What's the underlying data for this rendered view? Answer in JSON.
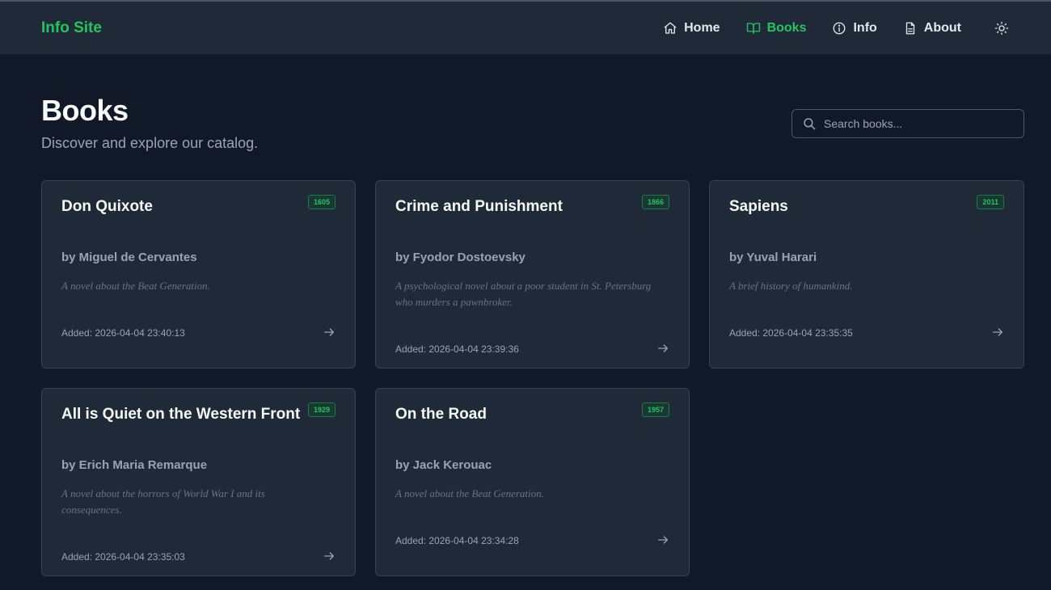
{
  "brand": "Info Site",
  "nav": {
    "home": "Home",
    "books": "Books",
    "info": "Info",
    "about": "About"
  },
  "page": {
    "title": "Books",
    "subtitle": "Discover and explore our catalog."
  },
  "search": {
    "placeholder": "Search books..."
  },
  "colors": {
    "accent": "#22c55e",
    "background": "#111827",
    "card": "#1f2937"
  },
  "books": [
    {
      "title": "Don Quixote",
      "year": "1605",
      "author": "by Miguel de Cervantes",
      "description": "A novel about the Beat Generation.",
      "added": "Added: 2026-04-04 23:40:13"
    },
    {
      "title": "Crime and Punishment",
      "year": "1866",
      "author": "by Fyodor Dostoevsky",
      "description": "A psychological novel about a poor student in St. Petersburg who murders a pawnbroker.",
      "added": "Added: 2026-04-04 23:39:36"
    },
    {
      "title": "Sapiens",
      "year": "2011",
      "author": "by Yuval Harari",
      "description": "A brief history of humankind.",
      "added": "Added: 2026-04-04 23:35:35"
    },
    {
      "title": "All is Quiet on the Western Front",
      "year": "1929",
      "author": "by Erich Maria Remarque",
      "description": "A novel about the horrors of World War I and its consequences.",
      "added": "Added: 2026-04-04 23:35:03"
    },
    {
      "title": "On the Road",
      "year": "1957",
      "author": "by Jack Kerouac",
      "description": "A novel about the Beat Generation.",
      "added": "Added: 2026-04-04 23:34:28"
    }
  ]
}
